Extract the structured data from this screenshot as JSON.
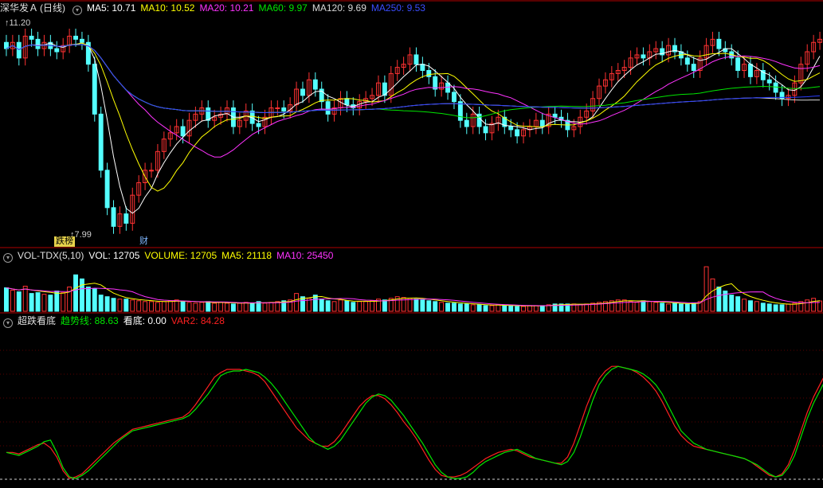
{
  "header": {
    "stock": "深华发Ａ",
    "period": "(日线)",
    "ma5": "MA5: 10.71",
    "ma10": "MA10: 10.52",
    "ma20": "MA20: 10.21",
    "ma60": "MA60: 9.97",
    "ma120": "MA120: 9.69",
    "ma250": "MA250: 9.53"
  },
  "price_panel": {
    "high_label": "11.20",
    "low_label": "7.99",
    "events": [
      "跌榜",
      "财"
    ]
  },
  "volume_panel": {
    "title": "VOL-TDX(5,10)",
    "vol": "VOL: 12705",
    "volume": "VOLUME: 12705",
    "ma5": "MA5: 21118",
    "ma10": "MA10: 25450"
  },
  "indicator_panel": {
    "title": "超跌看底",
    "trend": "趋势线: 88.63",
    "bottom": "看底: 0.00",
    "var2": "VAR2: 84.28"
  },
  "colors": {
    "up": "#ff3232",
    "down": "#54ffff",
    "ma5": "#ffffff",
    "ma10": "#ffff00",
    "ma20": "#ff33ff",
    "ma60": "#00e600",
    "ma120": "#d8d8d8",
    "ma250": "#2a3dff",
    "grid": "#8b0000",
    "trend": "#00e600",
    "var2": "#ff2020"
  },
  "chart_data": {
    "type": "candlestick",
    "close": [
      10.85,
      10.95,
      10.7,
      11.05,
      11.0,
      10.85,
      10.95,
      10.85,
      10.8,
      10.9,
      11.05,
      11.0,
      10.95,
      10.6,
      9.8,
      8.9,
      8.3,
      8.0,
      8.2,
      8.05,
      8.5,
      8.7,
      8.9,
      8.9,
      9.2,
      9.4,
      9.5,
      9.6,
      9.45,
      9.7,
      9.8,
      9.9,
      9.7,
      9.75,
      9.8,
      9.9,
      9.6,
      9.7,
      9.85,
      9.65,
      9.6,
      9.75,
      9.9,
      9.9,
      9.85,
      9.95,
      10.2,
      10.1,
      10.35,
      10.2,
      10.0,
      9.8,
      9.9,
      10.05,
      9.95,
      9.9,
      10.0,
      10.05,
      10.1,
      10.3,
      10.1,
      10.45,
      10.55,
      10.6,
      10.75,
      10.6,
      10.5,
      10.4,
      10.2,
      10.3,
      10.15,
      10.0,
      9.7,
      9.6,
      9.8,
      9.6,
      9.5,
      9.65,
      9.75,
      9.6,
      9.55,
      9.45,
      9.55,
      9.6,
      9.7,
      9.6,
      9.8,
      9.75,
      9.7,
      9.55,
      9.6,
      9.75,
      9.85,
      10.05,
      10.25,
      10.35,
      10.45,
      10.5,
      10.55,
      10.7,
      10.75,
      10.7,
      10.8,
      10.85,
      10.75,
      10.9,
      10.8,
      10.7,
      10.6,
      10.5,
      10.7,
      10.9,
      11.0,
      10.85,
      10.8,
      10.7,
      10.5,
      10.6,
      10.4,
      10.5,
      10.35,
      10.3,
      10.15,
      10.05,
      10.1,
      10.3,
      10.6,
      10.8,
      10.95,
      11.0
    ],
    "open": [
      10.95,
      10.85,
      10.95,
      10.7,
      11.05,
      11.0,
      10.85,
      10.95,
      10.85,
      10.8,
      10.9,
      11.05,
      11.0,
      10.95,
      10.6,
      9.8,
      8.9,
      8.3,
      8.0,
      8.2,
      8.05,
      8.5,
      8.7,
      8.9,
      8.9,
      9.2,
      9.4,
      9.5,
      9.6,
      9.45,
      9.7,
      9.8,
      9.9,
      9.7,
      9.75,
      9.8,
      9.9,
      9.6,
      9.7,
      9.85,
      9.65,
      9.6,
      9.75,
      9.9,
      9.9,
      9.85,
      9.95,
      10.2,
      10.1,
      10.35,
      10.2,
      10.0,
      9.8,
      9.9,
      10.05,
      9.95,
      9.9,
      10.0,
      10.05,
      10.1,
      10.3,
      10.1,
      10.45,
      10.55,
      10.6,
      10.75,
      10.6,
      10.5,
      10.4,
      10.2,
      10.3,
      10.15,
      10.0,
      9.7,
      9.6,
      9.8,
      9.6,
      9.5,
      9.65,
      9.75,
      9.6,
      9.55,
      9.45,
      9.55,
      9.6,
      9.7,
      9.6,
      9.8,
      9.75,
      9.7,
      9.55,
      9.6,
      9.75,
      9.85,
      10.05,
      10.25,
      10.35,
      10.45,
      10.5,
      10.55,
      10.7,
      10.75,
      10.7,
      10.8,
      10.85,
      10.75,
      10.9,
      10.8,
      10.7,
      10.6,
      10.5,
      10.7,
      10.9,
      11.0,
      10.85,
      10.8,
      10.7,
      10.5,
      10.6,
      10.4,
      10.5,
      10.35,
      10.3,
      10.15,
      10.05,
      10.1,
      10.3,
      10.6,
      10.8,
      10.95
    ],
    "volume": [
      29000,
      26000,
      24000,
      31000,
      22000,
      23000,
      21000,
      20000,
      25000,
      23000,
      30000,
      45000,
      40000,
      30000,
      28000,
      20000,
      18000,
      16000,
      15000,
      15000,
      14000,
      13000,
      12000,
      12000,
      11000,
      12000,
      13000,
      14000,
      12000,
      11000,
      10000,
      11000,
      12000,
      10000,
      11000,
      10000,
      9000,
      10000,
      11000,
      10000,
      12000,
      10000,
      11000,
      12000,
      13000,
      14000,
      22000,
      18000,
      16000,
      20000,
      15000,
      13000,
      12000,
      14000,
      13000,
      11000,
      12000,
      12000,
      13000,
      15000,
      14000,
      16000,
      18000,
      17000,
      16000,
      15000,
      14000,
      13000,
      12000,
      11000,
      10000,
      10000,
      9000,
      9000,
      8000,
      8000,
      7000,
      7000,
      8000,
      7000,
      7000,
      6000,
      6000,
      7000,
      7000,
      7000,
      8000,
      9000,
      9000,
      9000,
      9000,
      8000,
      9000,
      10000,
      11000,
      12000,
      13000,
      14000,
      14000,
      12000,
      11000,
      13000,
      12000,
      11000,
      10000,
      9000,
      10000,
      9000,
      9000,
      10000,
      12000,
      55000,
      40000,
      30000,
      25000,
      20000,
      18000,
      15000,
      13000,
      12000,
      10000,
      9000,
      8000,
      8000,
      9000,
      10000,
      12000,
      14000,
      16000,
      12705
    ],
    "trend_line": [
      18,
      17,
      16,
      18,
      20,
      22,
      25,
      26,
      18,
      8,
      2,
      1,
      3,
      6,
      10,
      14,
      18,
      22,
      26,
      29,
      32,
      33,
      34,
      35,
      36,
      37,
      38,
      39,
      40,
      42,
      46,
      51,
      56,
      62,
      68,
      70,
      71,
      71,
      72,
      71,
      70,
      67,
      63,
      58,
      52,
      46,
      40,
      34,
      28,
      24,
      22,
      20,
      22,
      26,
      32,
      38,
      44,
      50,
      54,
      56,
      55,
      52,
      47,
      42,
      36,
      30,
      24,
      17,
      10,
      5,
      2,
      1,
      1,
      2,
      5,
      9,
      12,
      14,
      16,
      18,
      19,
      20,
      18,
      16,
      14,
      13,
      12,
      11,
      10,
      12,
      18,
      28,
      40,
      52,
      62,
      68,
      72,
      74,
      73,
      72,
      71,
      69,
      66,
      62,
      56,
      48,
      40,
      32,
      28,
      24,
      22,
      20,
      19,
      18,
      17,
      16,
      15,
      14,
      12,
      10,
      7,
      4,
      2,
      3,
      8,
      16,
      28,
      40,
      50,
      58,
      66,
      72,
      78,
      84,
      88.63
    ],
    "var2": [
      18,
      18,
      17,
      19,
      21,
      23,
      24,
      21,
      15,
      6,
      1,
      2,
      4,
      8,
      12,
      16,
      20,
      24,
      27,
      30,
      33,
      34,
      35,
      36,
      37,
      38,
      39,
      40,
      41,
      44,
      49,
      55,
      61,
      67,
      70,
      72,
      72,
      72,
      71,
      70,
      68,
      64,
      58,
      52,
      46,
      40,
      34,
      30,
      26,
      24,
      22,
      22,
      25,
      30,
      36,
      42,
      48,
      52,
      55,
      55,
      53,
      49,
      44,
      38,
      33,
      27,
      20,
      13,
      7,
      3,
      2,
      2,
      3,
      5,
      8,
      11,
      14,
      16,
      18,
      19,
      20,
      19,
      17,
      15,
      14,
      13,
      12,
      11,
      11,
      15,
      24,
      36,
      48,
      58,
      66,
      71,
      74,
      74,
      73,
      72,
      70,
      67,
      63,
      58,
      51,
      43,
      35,
      29,
      25,
      22,
      21,
      20,
      19,
      18,
      17,
      16,
      15,
      14,
      12,
      9,
      6,
      3,
      2,
      4,
      10,
      20,
      32,
      44,
      54,
      62,
      70,
      76,
      80,
      82,
      84.28
    ]
  }
}
